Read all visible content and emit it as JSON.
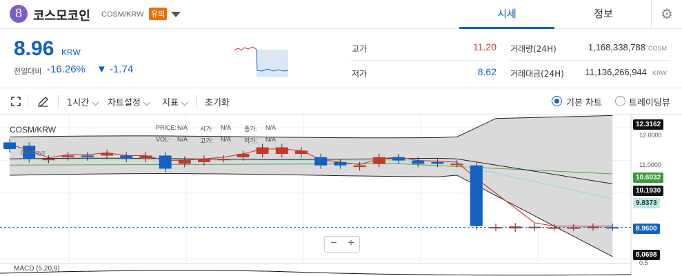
{
  "header": {
    "coin_name": "코스모코인",
    "pair": "COSM/KRW",
    "warning_badge": "유의",
    "logo_glyph": "8",
    "tabs": [
      "시세",
      "정보"
    ],
    "active_tab": "시세"
  },
  "price": {
    "current": "8.96",
    "unit": "KRW",
    "change_label": "전일대비",
    "change_rate": "-16.26%",
    "change_amount": "▼ -1.74"
  },
  "stats": {
    "high_label": "고가",
    "high_value": "11.20",
    "low_label": "저가",
    "low_value": "8.62",
    "volume_label": "거래량(24H)",
    "volume_value": "1,168,338,788",
    "volume_unit": "COSM",
    "amount_label": "거래대금(24H)",
    "amount_value": "11,136,266,944",
    "amount_unit": "KRW"
  },
  "toolbar": {
    "interval": "1시간",
    "chart_settings": "차트설정",
    "indicators": "지표",
    "reset": "초기화",
    "basic_chart": "기본 차트",
    "trading_view": "트레이딩뷰",
    "selected_chart": "기본 차트"
  },
  "chart": {
    "symbol": "COSM/KRW",
    "overlays_label": "Overlays",
    "ohlc": {
      "price_label": "PRICE:",
      "price_val": "N/A",
      "open_label": "시가:",
      "open_val": "N/A",
      "close_label": "종가:",
      "close_val": "N/A",
      "vol_label": "VOL:",
      "vol_val": "N/A",
      "high_label": "고가:",
      "high_val": "N/A",
      "low_label": "저가:",
      "low_val": "N/A"
    },
    "axis_ticks": [
      "12.0000",
      "11.0000",
      "0.5"
    ],
    "tags": {
      "bb_upper": "12.3162",
      "ma_green": "10.6032",
      "bb_mid": "10.1930",
      "ma_teal": "9.8373",
      "current": "8.9600",
      "bb_lower": "8.0698"
    },
    "macd_label": "MACD (5,20,9)",
    "zoom_minus": "−",
    "zoom_plus": "+"
  },
  "colors": {
    "up": "#c0392b",
    "down": "#1261c4",
    "accent": "#1261c4",
    "warning": "#e8710a"
  },
  "chart_data": {
    "type": "candlestick",
    "candles": [
      {
        "o": 11.55,
        "c": 11.35
      },
      {
        "o": 11.45,
        "c": 11.05
      },
      {
        "o": 11.02,
        "c": 11.05
      },
      {
        "o": 11.1,
        "c": 11.15
      },
      {
        "o": 11.15,
        "c": 11.1
      },
      {
        "o": 11.15,
        "c": 11.22
      },
      {
        "o": 11.15,
        "c": 11.05
      },
      {
        "o": 11.05,
        "c": 11.15
      },
      {
        "o": 11.15,
        "c": 10.75
      },
      {
        "o": 10.9,
        "c": 11.02
      },
      {
        "o": 10.95,
        "c": 11.05
      },
      {
        "o": 11.05,
        "c": 11.05
      },
      {
        "o": 11.1,
        "c": 11.2
      },
      {
        "o": 11.2,
        "c": 11.4
      },
      {
        "o": 11.2,
        "c": 11.4
      },
      {
        "o": 11.2,
        "c": 11.3
      },
      {
        "o": 11.1,
        "c": 10.85
      },
      {
        "o": 10.95,
        "c": 10.85
      },
      {
        "o": 10.8,
        "c": 10.85
      },
      {
        "o": 10.9,
        "c": 11.1
      },
      {
        "o": 11.1,
        "c": 11.0
      },
      {
        "o": 11.0,
        "c": 10.9
      },
      {
        "o": 10.95,
        "c": 10.9
      },
      {
        "o": 10.9,
        "c": 10.9
      },
      {
        "o": 10.85,
        "c": 9.0
      },
      {
        "o": 8.95,
        "c": 8.97
      },
      {
        "o": 8.93,
        "c": 8.99
      },
      {
        "o": 8.96,
        "c": 8.98
      },
      {
        "o": 8.96,
        "c": 8.96
      },
      {
        "o": 8.96,
        "c": 8.96
      },
      {
        "o": 8.97,
        "c": 8.98
      },
      {
        "o": 8.97,
        "c": 8.96
      }
    ],
    "ylim": [
      7.9,
      12.4
    ]
  }
}
